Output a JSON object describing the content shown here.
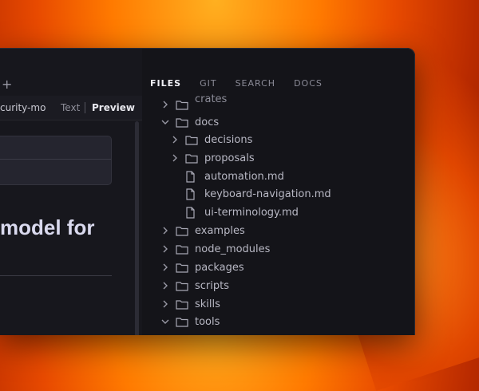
{
  "editor": {
    "new_tab_glyph": "+",
    "tab_title": "curity-mo",
    "mode_text": "Text",
    "mode_preview": "Preview",
    "heading": "model for"
  },
  "sidebar": {
    "tabs": [
      {
        "label": "FILES",
        "active": true
      },
      {
        "label": "GIT",
        "active": false
      },
      {
        "label": "SEARCH",
        "active": false
      },
      {
        "label": "DOCS",
        "active": false
      }
    ],
    "tree": [
      {
        "label": "crates",
        "type": "folder",
        "expanded": false,
        "depth": 0
      },
      {
        "label": "docs",
        "type": "folder",
        "expanded": true,
        "depth": 0
      },
      {
        "label": "decisions",
        "type": "folder",
        "expanded": false,
        "depth": 1
      },
      {
        "label": "proposals",
        "type": "folder",
        "expanded": false,
        "depth": 1
      },
      {
        "label": "automation.md",
        "type": "file",
        "depth": 1
      },
      {
        "label": "keyboard-navigation.md",
        "type": "file",
        "depth": 1
      },
      {
        "label": "ui-terminology.md",
        "type": "file",
        "depth": 1
      },
      {
        "label": "examples",
        "type": "folder",
        "expanded": false,
        "depth": 0
      },
      {
        "label": "node_modules",
        "type": "folder",
        "expanded": false,
        "depth": 0
      },
      {
        "label": "packages",
        "type": "folder",
        "expanded": false,
        "depth": 0
      },
      {
        "label": "scripts",
        "type": "folder",
        "expanded": false,
        "depth": 0
      },
      {
        "label": "skills",
        "type": "folder",
        "expanded": false,
        "depth": 0
      },
      {
        "label": "tools",
        "type": "folder",
        "expanded": true,
        "depth": 0
      }
    ]
  },
  "icons": {
    "folder": "folder-icon",
    "file": "file-icon",
    "chevron_right": "chevron-right-icon",
    "chevron_down": "chevron-down-icon"
  },
  "colors": {
    "window_bg": "#141419",
    "active_tab": "#f0f0f6",
    "inactive_tab": "#8a8a96",
    "tree_text": "#b8b8c4"
  }
}
